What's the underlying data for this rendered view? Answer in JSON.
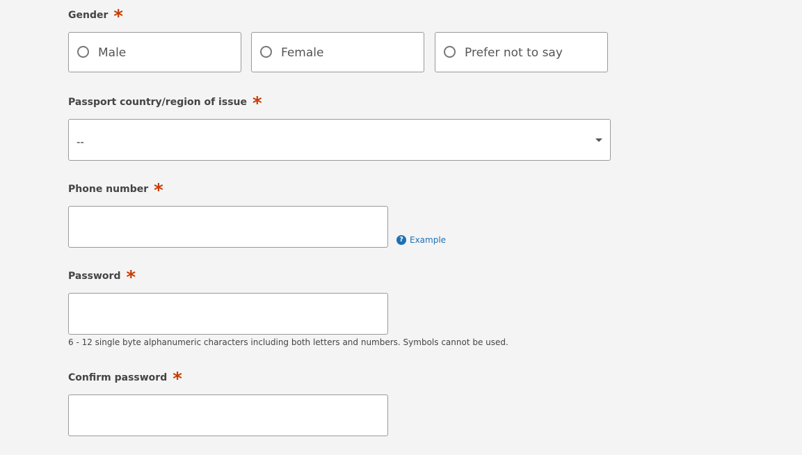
{
  "gender": {
    "label": "Gender",
    "required_mark": "*",
    "options": [
      "Male",
      "Female",
      "Prefer not to say"
    ]
  },
  "passport": {
    "label": "Passport country/region of issue",
    "required_mark": "*",
    "selected": "--"
  },
  "phone": {
    "label": "Phone number",
    "required_mark": "*",
    "value": "",
    "help_icon": "?",
    "help_link": "Example"
  },
  "password": {
    "label": "Password",
    "required_mark": "*",
    "value": "",
    "hint": "6 - 12 single byte alphanumeric characters including both letters and numbers. Symbols cannot be used."
  },
  "confirm_password": {
    "label": "Confirm password",
    "required_mark": "*",
    "value": ""
  },
  "colors": {
    "background": "#f4f4f4",
    "required_mark": "#c83c00",
    "link": "#1f6fb2",
    "border": "#999999"
  },
  "icons": {
    "radio": "radio-unselected-icon",
    "select_arrow": "caret-down-icon",
    "help": "question-circle-icon"
  }
}
